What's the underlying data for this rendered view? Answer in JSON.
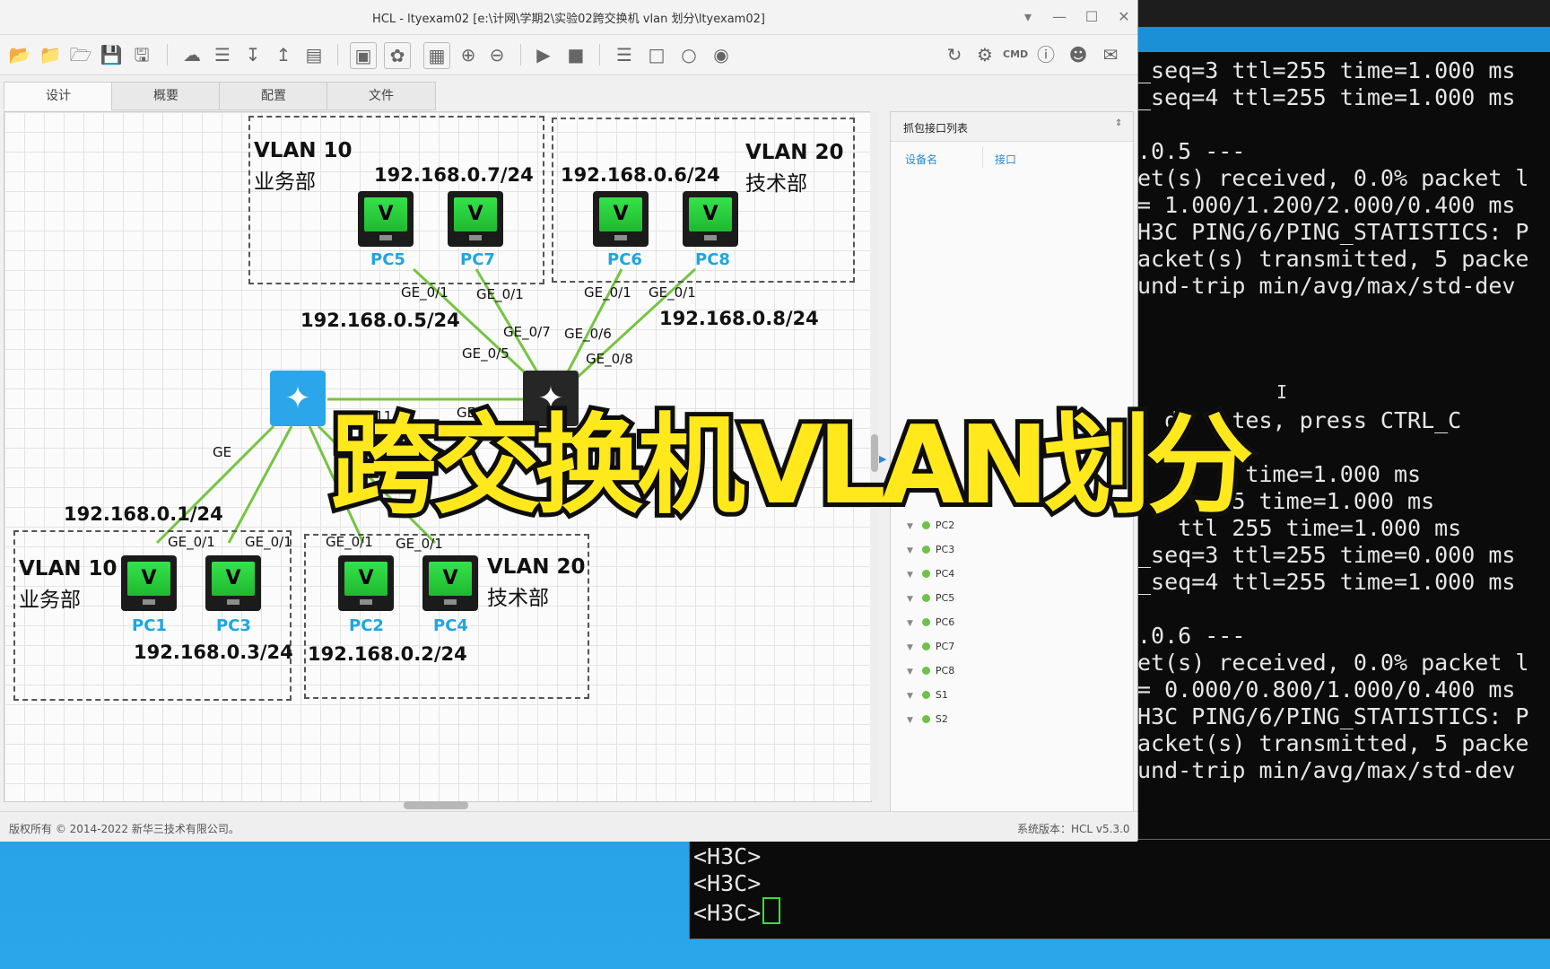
{
  "window": {
    "title": "HCL - ltyexam02 [e:\\计网\\学期2\\实验02跨交换机 vlan 划分\\ltyexam02]",
    "controls": [
      "▾",
      "—",
      "☐",
      "✕"
    ]
  },
  "toolbar": {
    "icons": [
      "open-project-icon",
      "open-folder-icon",
      "folder-icon",
      "save-icon",
      "save-as-icon",
      "cloud-icon",
      "layers-icon",
      "import-icon",
      "export-icon",
      "report-icon",
      "capture-icon",
      "topology-icon",
      "grid-icon",
      "zoom-in-icon",
      "zoom-out-icon",
      "start-icon",
      "stop-icon",
      "add-list-icon",
      "add-shape-icon",
      "add-rect-icon",
      "camera-icon",
      "refresh-icon",
      "settings-icon",
      "cmd-icon",
      "help-icon",
      "wechat-icon",
      "feedback-icon"
    ]
  },
  "tabs": [
    {
      "label": "设计",
      "active": true
    },
    {
      "label": "概要",
      "active": false
    },
    {
      "label": "配置",
      "active": false
    },
    {
      "label": "文件",
      "active": false
    }
  ],
  "topology": {
    "groups": [
      {
        "vlan": "VLAN 10",
        "dept": "业务部"
      },
      {
        "vlan": "VLAN 20",
        "dept": "技术部"
      },
      {
        "vlan": "VLAN 10",
        "dept": "业务部"
      },
      {
        "vlan": "VLAN 20",
        "dept": "技术部"
      }
    ],
    "pcs": [
      {
        "name": "PC5",
        "glyph": "V"
      },
      {
        "name": "PC7",
        "glyph": "V"
      },
      {
        "name": "PC6",
        "glyph": "V"
      },
      {
        "name": "PC8",
        "glyph": "V"
      },
      {
        "name": "PC1",
        "glyph": "V"
      },
      {
        "name": "PC3",
        "glyph": "V"
      },
      {
        "name": "PC2",
        "glyph": "V"
      },
      {
        "name": "PC4",
        "glyph": "V"
      }
    ],
    "ips": [
      "192.168.0.7/24",
      "192.168.0.6/24",
      "192.168.0.5/24",
      "192.168.0.8/24",
      "192.168.0.1/24",
      "192.168.0.3/24",
      "192.168.0.2/24"
    ],
    "ports": [
      "GE_0/1",
      "GE_0/1",
      "GE_0/1",
      "GE_0/1",
      "GE_0/7",
      "GE_0/6",
      "GE_0/5",
      "GE_0/8",
      "GE_0/11",
      "GE_0",
      "GE",
      "GE_0/1",
      "GE_0/1",
      "GE_0/1",
      "GE_0/1"
    ]
  },
  "capture_panel": {
    "title": "抓包接口列表",
    "col_device": "设备名",
    "col_interface": "接口",
    "devices": [
      "PC2",
      "PC3",
      "PC4",
      "PC5",
      "PC6",
      "PC7",
      "PC8",
      "S1",
      "S2"
    ]
  },
  "status": {
    "copyright": "版权所有 © 2014-2022 新华三技术有限公司。",
    "version": "系统版本：HCL v5.3.0"
  },
  "terminal": {
    "lines": [
      "_seq=3 ttl=255 time=1.000 ms",
      "_seq=4 ttl=255 time=1.000 ms",
      "",
      ".0.5 ---",
      "et(s) received, 0.0% packet l",
      "= 1.000/1.200/2.000/0.400 ms",
      "H3C PING/6/PING_STATISTICS: P",
      "acket(s) transmitted, 5 packe",
      "und-trip min/avg/max/std-dev",
      "",
      "",
      "",
      "",
      "  da   tes, press CTRL_C",
      "",
      "      5 time=1.000 ms",
      "      55 time=1.000 ms",
      "   ttl 255 time=1.000 ms",
      "_seq=3 ttl=255 time=0.000 ms",
      "_seq=4 ttl=255 time=1.000 ms",
      "",
      ".0.6 ---",
      "et(s) received, 0.0% packet l",
      "= 0.000/0.800/1.000/0.400 ms",
      "H3C PING/6/PING_STATISTICS: P",
      "acket(s) transmitted, 5 packe",
      "und-trip min/avg/max/std-dev"
    ],
    "text_cursor": "I",
    "prompt_lines": [
      "<H3C>",
      "<H3C>",
      "<H3C>"
    ]
  },
  "caption": "跨交换机VLAN划分"
}
